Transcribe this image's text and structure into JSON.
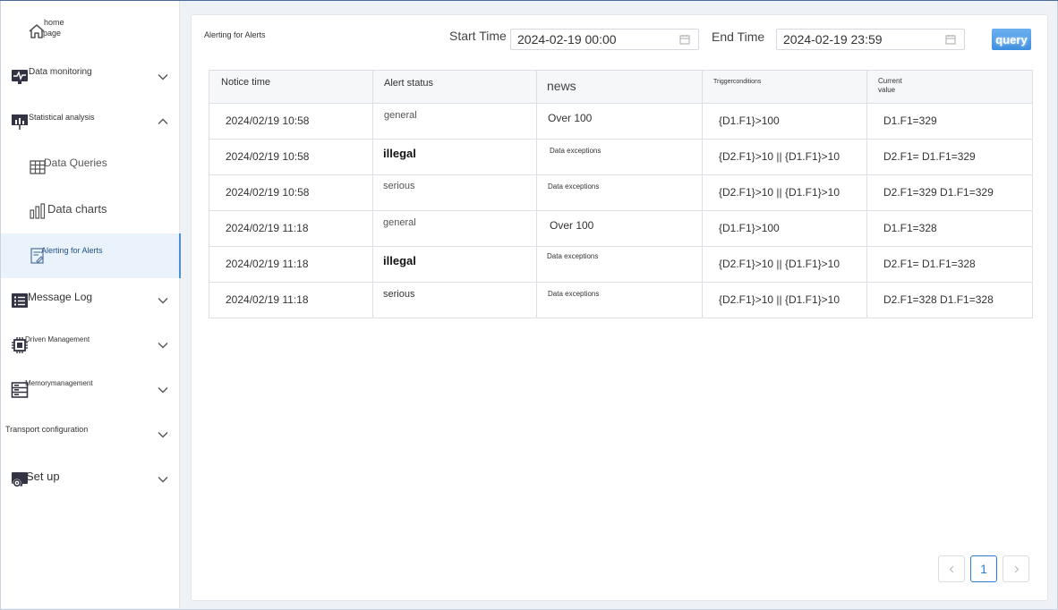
{
  "sidebar": {
    "home": "home page",
    "home_l1": "home",
    "home_l2": "page",
    "data_monitoring": "Data monitoring",
    "statistical_analysis": "Statistical analysis",
    "data_queries": "Data Queries",
    "data_charts": "Data charts",
    "alerting": "Alerting for Alerts",
    "message_log": "Message Log",
    "driven_management": "Driven Management",
    "memory_management": "Memorymanagement",
    "transport_configuration": "Transport configuration",
    "set_up": "Set up"
  },
  "main": {
    "title": "Alerting for Alerts",
    "start_label": "Start Time",
    "start_value": "2024-02-19 00:00",
    "end_label": "End Time",
    "end_value": "2024-02-19 23:59",
    "query_label": "query"
  },
  "table": {
    "headers": {
      "notice": "Notice time",
      "status": "Alert status",
      "news": "news",
      "trigger": "Triggerconditions",
      "current_l1": "Current",
      "current_l2": "value"
    },
    "rows": [
      {
        "time": "2024/02/19 10:58",
        "status": "general",
        "news": "Over 100",
        "trigger": "{D1.F1}>100",
        "value": "D1.F1=329"
      },
      {
        "time": "2024/02/19 10:58",
        "status": "illegal",
        "news": "Data exceptions",
        "trigger": "{D2.F1}>10 || {D1.F1}>10",
        "value": "D2.F1= D1.F1=329"
      },
      {
        "time": "2024/02/19 10:58",
        "status": "serious",
        "news": "Data exceptions",
        "trigger": "{D2.F1}>10 || {D1.F1}>10",
        "value": "D2.F1=329 D1.F1=329"
      },
      {
        "time": "2024/02/19 11:18",
        "status": "general",
        "news": "Over 100",
        "trigger": "{D1.F1}>100",
        "value": "D1.F1=328"
      },
      {
        "time": "2024/02/19 11:18",
        "status": "illegal",
        "news": "Data exceptions",
        "trigger": "{D2.F1}>10 || {D1.F1}>10",
        "value": "D2.F1= D1.F1=328"
      },
      {
        "time": "2024/02/19 11:18",
        "status": "serious",
        "news": "Data exceptions",
        "trigger": "{D2.F1}>10 || {D1.F1}>10",
        "value": "D2.F1=328 D1.F1=328"
      }
    ]
  },
  "pagination": {
    "current": "1",
    "prev_icon": "chevron-left-icon",
    "next_icon": "chevron-right-icon"
  },
  "colors": {
    "accent": "#2f7bd5",
    "active_bg": "#eaf3fc",
    "query_button": "#4a97e6"
  }
}
